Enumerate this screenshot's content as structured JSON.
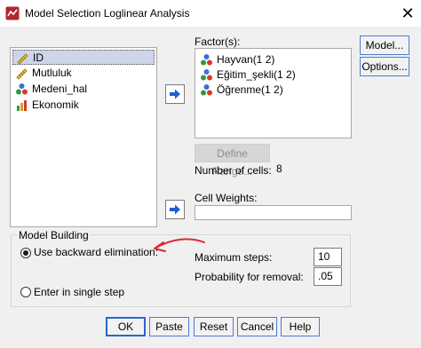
{
  "window": {
    "title": "Model Selection Loglinear Analysis",
    "close": "✕"
  },
  "variables": [
    {
      "label": "ID",
      "icon": "scale-ruler-icon",
      "selected": true
    },
    {
      "label": "Mutluluk",
      "icon": "scale-ruler-icon",
      "selected": false
    },
    {
      "label": "Medeni_hal",
      "icon": "nominal-balls-icon",
      "selected": false
    },
    {
      "label": "Ekonomik",
      "icon": "ordinal-bars-icon",
      "selected": false
    }
  ],
  "factors": {
    "label": "Factor(s):",
    "items": [
      "Hayvan(1 2)",
      "Eğitim_şekli(1 2)",
      "Öğrenme(1 2)"
    ]
  },
  "define_range": "Define Range...",
  "number_of_cells": {
    "label": "Number of cells:",
    "value": "8"
  },
  "cell_weights": {
    "label": "Cell Weights:",
    "value": ""
  },
  "side_buttons": {
    "model": "Model...",
    "options": "Options..."
  },
  "model_building": {
    "title": "Model Building",
    "backward": "Use backward elimination:",
    "single": "Enter in single step",
    "selected": "backward",
    "max_steps_label": "Maximum steps:",
    "max_steps_value": "10",
    "prob_label": "Probability for removal:",
    "prob_value": ".05"
  },
  "buttons": {
    "ok": "OK",
    "paste": "Paste",
    "reset": "Reset",
    "cancel": "Cancel",
    "help": "Help"
  },
  "colors": {
    "accent": "#2a66c9",
    "arrow": "#1f5fd1",
    "annotation": "#e3262f"
  }
}
